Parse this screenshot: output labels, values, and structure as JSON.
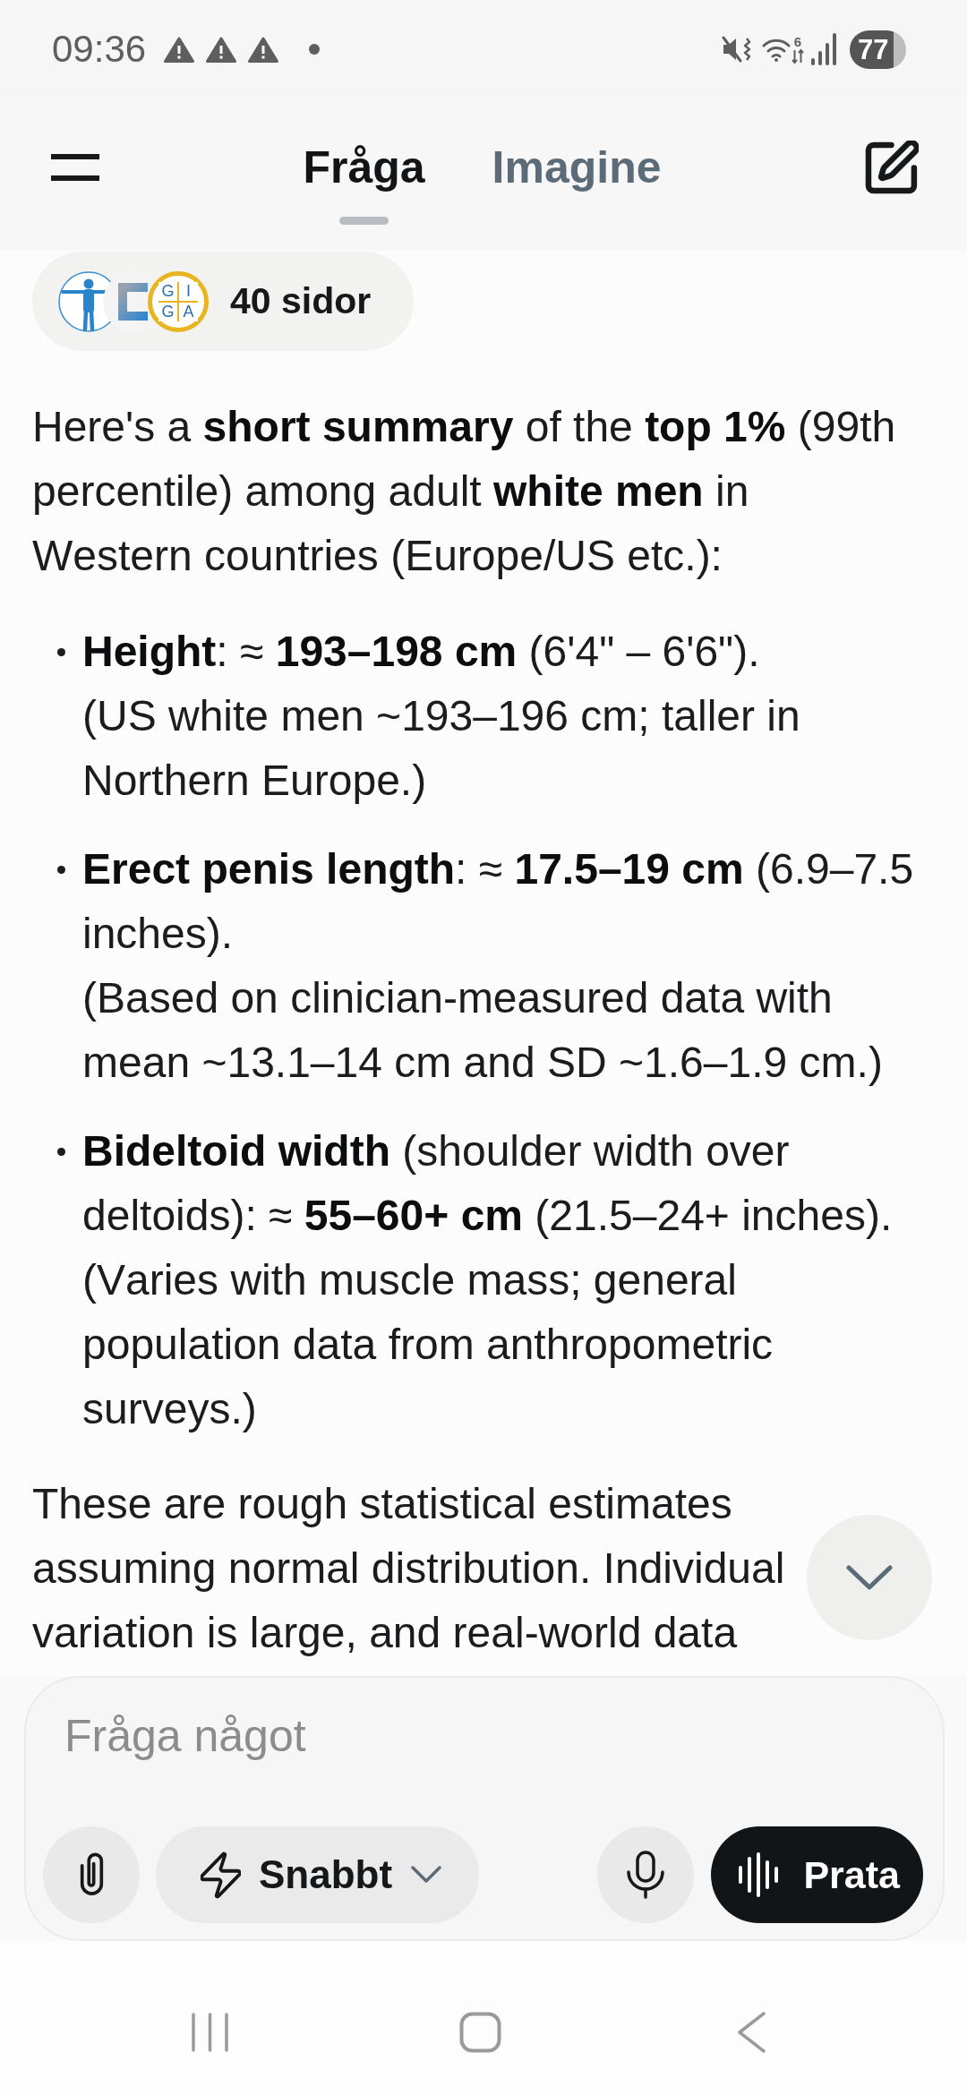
{
  "status_bar": {
    "time": "09:36",
    "wifi_label": "6",
    "battery": "77"
  },
  "header": {
    "tabs": [
      {
        "label": "Fråga",
        "selected": true
      },
      {
        "label": "Imagine",
        "selected": false
      }
    ]
  },
  "sources": {
    "label": "40 sidor",
    "logo_letters": [
      "G",
      "I",
      "G",
      "A"
    ]
  },
  "answer": {
    "intro": "Here's a **short summary** of the **top 1%** (99th percentile) among adult **white men** in Western countries (Europe/US etc.):",
    "bullets": [
      {
        "lines": [
          "**Height**: ≈ **193–198 cm** (6'4\" – 6'6\").",
          "(US white men ~193–196 cm; taller in Northern Europe.)"
        ]
      },
      {
        "lines": [
          "**Erect penis length**: ≈ **17.5–19 cm** (6.9–7.5 inches).",
          "(Based on clinician-measured data with mean ~13.1–14 cm and SD ~1.6–1.9 cm.)"
        ]
      },
      {
        "lines": [
          "**Bideltoid width** (shoulder width over deltoids): ≈ **55–60+ cm** (21.5–24+ inches).",
          "(Varies with muscle mass; general population data from anthropometric surveys.)"
        ]
      }
    ],
    "outro": "These are rough statistical estimates assuming normal distribution. Individual variation is large, and real-world data"
  },
  "composer": {
    "placeholder": "Fråga något",
    "mode": "Snabbt",
    "voice_button": "Prata"
  }
}
